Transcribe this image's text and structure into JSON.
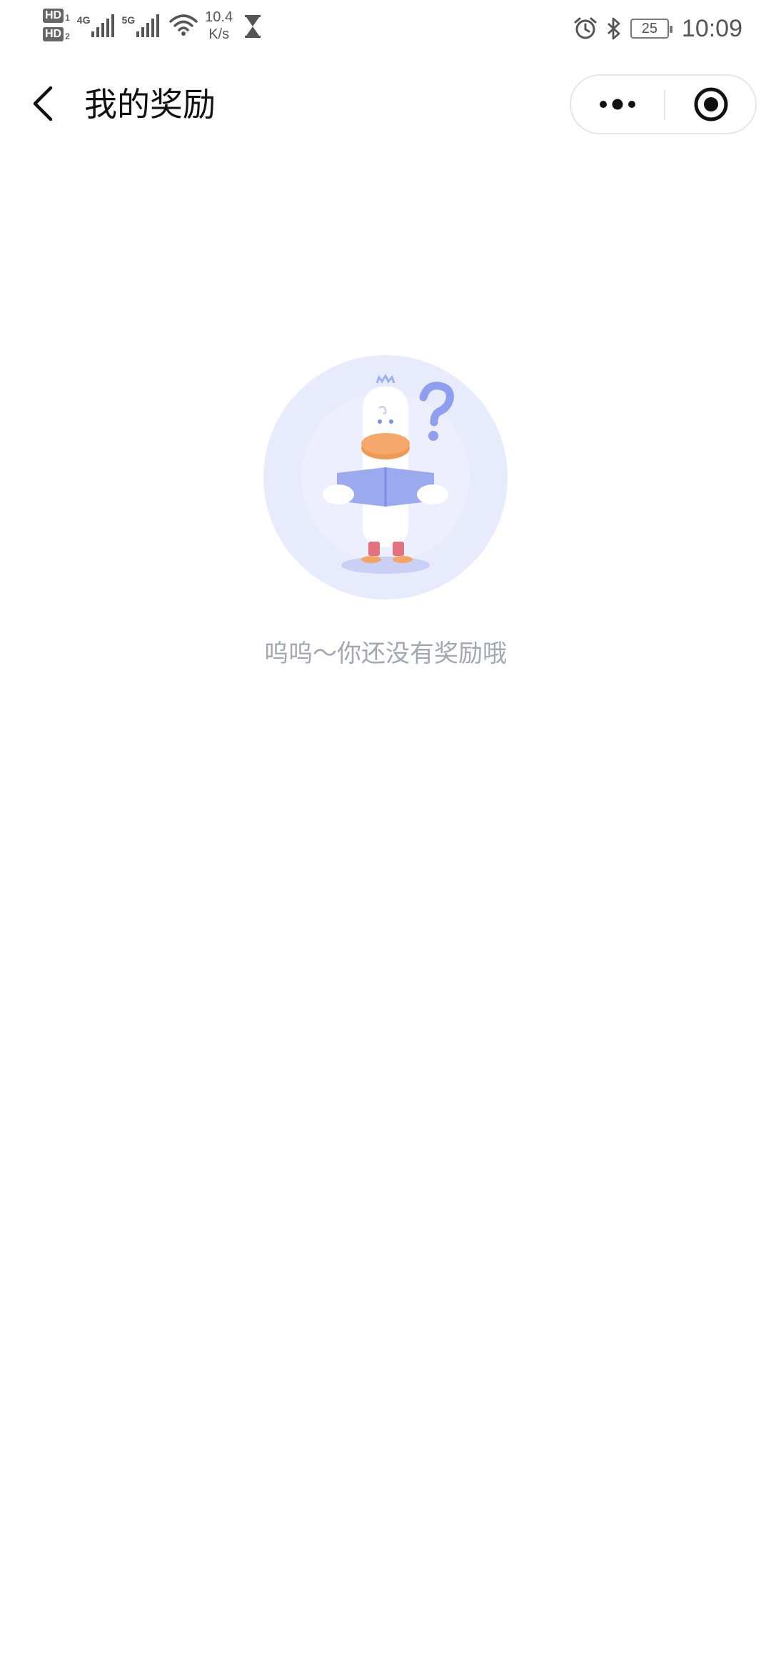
{
  "status_bar": {
    "hd1_label": "HD",
    "hd1_sub": "1",
    "hd2_label": "HD",
    "hd2_sub": "2",
    "net1_type": "4G",
    "net2_type": "5G",
    "speed_value": "10.4",
    "speed_unit": "K/s",
    "battery_level": "25",
    "time": "10:09",
    "icons": [
      "signal-icon",
      "wifi-icon",
      "hourglass-icon",
      "alarm-icon",
      "bluetooth-icon",
      "battery-icon"
    ]
  },
  "navbar": {
    "title": "我的奖励",
    "back_icon": "chevron-left-icon",
    "more_icon": "more-dots-icon",
    "close_icon": "target-circle-icon"
  },
  "empty_state": {
    "message": "呜呜～你还没有奖励哦",
    "illustration": "duck-reading-book-with-question-mark"
  },
  "colors": {
    "background": "#ffffff",
    "empty_text": "#a3a7b2",
    "illustration_circle": "#e8ebfb",
    "duck_beak": "#f5a869",
    "book": "#9ba9ef",
    "boots": "#e4717f"
  }
}
